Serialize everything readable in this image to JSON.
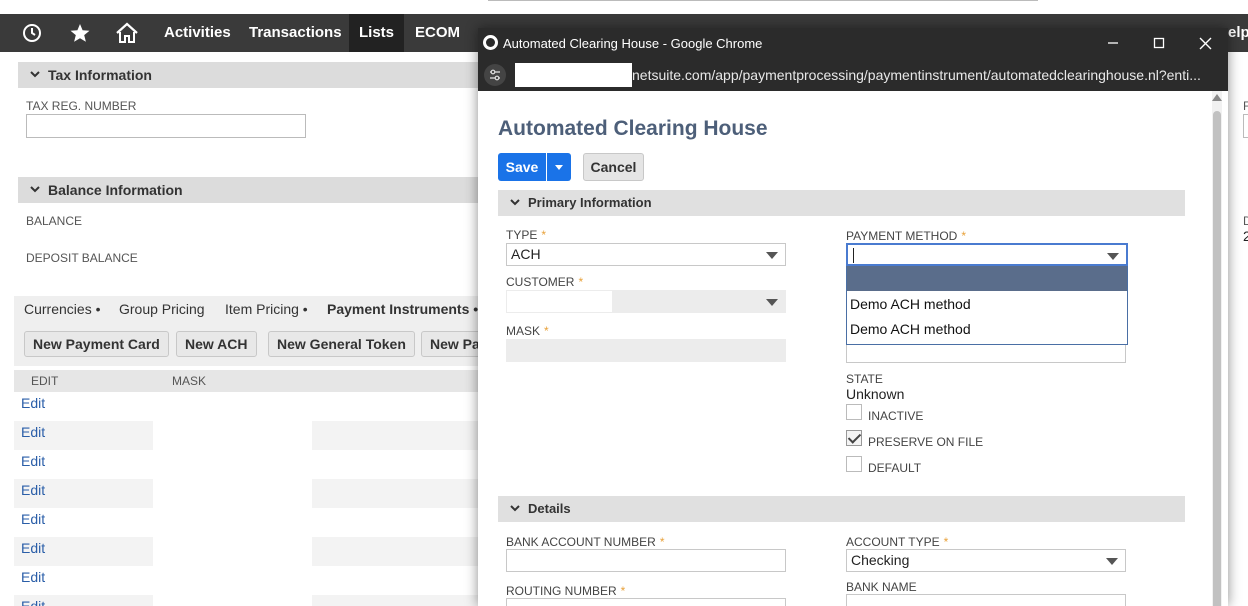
{
  "nav": {
    "items": [
      "Activities",
      "Transactions",
      "Lists",
      "ECOM"
    ],
    "active": "Lists",
    "right_fragment": "elp"
  },
  "background": {
    "tax_section": "Tax Information",
    "tax_reg_label": "TAX REG. NUMBER",
    "balance_section": "Balance Information",
    "balance_label": "BALANCE",
    "deposit_balance_label": "DEPOSIT BALANCE",
    "subtabs": [
      "Currencies •",
      "Group Pricing",
      "Item Pricing •",
      "Payment Instruments •"
    ],
    "buttons": [
      "New Payment Card",
      "New ACH",
      "New General Token",
      "New Pa"
    ],
    "table_headers": [
      "EDIT",
      "MASK"
    ],
    "row_action": "Edit",
    "right_fragments": [
      "F",
      "D",
      "2"
    ]
  },
  "window": {
    "title": "Automated Clearing House - Google Chrome",
    "url": "netsuite.com/app/paymentprocessing/paymentinstrument/automatedclearinghouse.nl?enti..."
  },
  "form": {
    "title": "Automated Clearing House",
    "save_label": "Save",
    "cancel_label": "Cancel",
    "primary_section": "Primary Information",
    "type_label": "TYPE",
    "type_value": "ACH",
    "customer_label": "CUSTOMER",
    "mask_label": "MASK",
    "payment_method_label": "PAYMENT METHOD",
    "payment_method_options": [
      "Demo ACH method",
      "Demo ACH method"
    ],
    "state_label": "STATE",
    "state_value": "Unknown",
    "inactive_label": "INACTIVE",
    "preserve_label": "PRESERVE ON FILE",
    "preserve_checked": true,
    "default_label": "DEFAULT",
    "details_section": "Details",
    "bank_account_label": "BANK ACCOUNT NUMBER",
    "account_type_label": "ACCOUNT TYPE",
    "account_type_value": "Checking",
    "routing_label": "ROUTING NUMBER",
    "bank_name_label": "BANK NAME",
    "required_mark": "*"
  },
  "colors": {
    "nav_bg": "#3a3a3a",
    "primary_button": "#1a73e8",
    "title_color": "#4d5f79",
    "required": "#e8a13a"
  }
}
